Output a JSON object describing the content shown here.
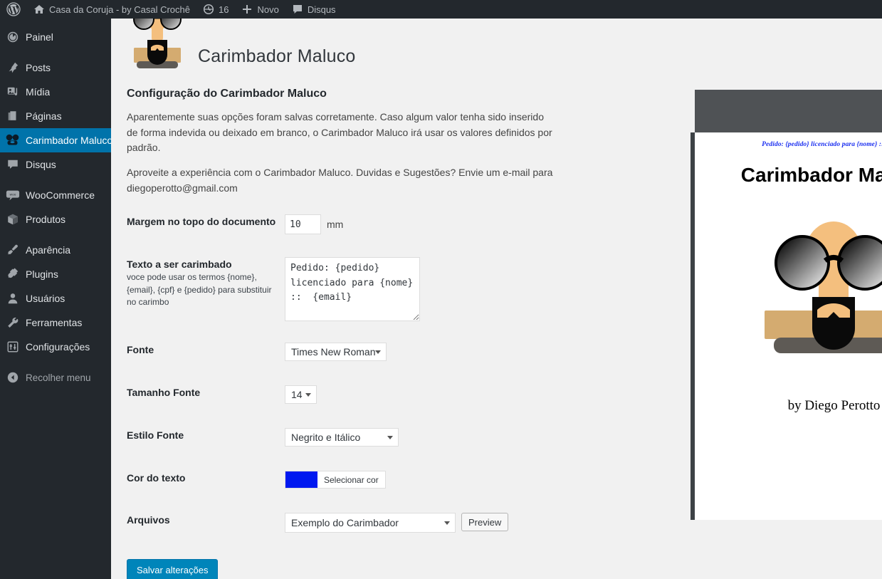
{
  "adminbar": {
    "wp_logo": "wordpress-logo-icon",
    "site": {
      "icon": "home-icon",
      "label": "Casa da Coruja - by Casal Crochê"
    },
    "updates": {
      "icon": "updates-icon",
      "label": "16"
    },
    "new": {
      "icon": "plus-icon",
      "label": "Novo"
    },
    "comments": {
      "icon": "comment-icon",
      "label": "Disqus"
    }
  },
  "sidebar": {
    "items": [
      {
        "label": "Painel",
        "icon": "dashboard-icon",
        "current": false
      },
      {
        "label": "Posts",
        "icon": "pin-icon",
        "current": false
      },
      {
        "label": "Mídia",
        "icon": "media-icon",
        "current": false
      },
      {
        "label": "Páginas",
        "icon": "pages-icon",
        "current": false
      },
      {
        "label": "Carimbador Maluco",
        "icon": "carimbador-icon",
        "current": true
      },
      {
        "label": "Disqus",
        "icon": "comment-icon",
        "current": false
      },
      {
        "label": "WooCommerce",
        "icon": "woocommerce-icon",
        "current": false
      },
      {
        "label": "Produtos",
        "icon": "box-icon",
        "current": false
      },
      {
        "label": "Aparência",
        "icon": "brush-icon",
        "current": false
      },
      {
        "label": "Plugins",
        "icon": "plug-icon",
        "current": false
      },
      {
        "label": "Usuários",
        "icon": "user-icon",
        "current": false
      },
      {
        "label": "Ferramentas",
        "icon": "wrench-icon",
        "current": false
      },
      {
        "label": "Configurações",
        "icon": "settings-icon",
        "current": false
      }
    ],
    "collapse": {
      "label": "Recolher menu",
      "icon": "collapse-arrow-icon"
    }
  },
  "page": {
    "plugin_title": "Carimbador Maluco",
    "section_title": "Configuração do Carimbador Maluco",
    "paragraph1": "Aparentemente suas opções foram salvas corretamente. Caso algum valor tenha sido inserido de forma indevida ou deixado em branco, o Carimbador Maluco irá usar os valores definidos por padrão.",
    "paragraph2": "Aproveite a experiência com o Carimbador Maluco. Duvidas e Sugestões? Envie um e-mail para diegoperotto@gmail.com"
  },
  "form": {
    "margem": {
      "label": "Margem no topo do documento",
      "value": "10",
      "unit": "mm"
    },
    "texto": {
      "label": "Texto a ser carimbado",
      "hint": "voce pode usar os termos {nome}, {email}, {cpf} e {pedido} para substituir no carimbo",
      "value": "Pedido: {pedido} licenciado para {nome} ::  {email}"
    },
    "fonte": {
      "label": "Fonte",
      "value": "Times New Roman"
    },
    "tamanho": {
      "label": "Tamanho Fonte",
      "value": "14"
    },
    "estilo": {
      "label": "Estilo Fonte",
      "value": "Negrito e Itálico"
    },
    "cor": {
      "label": "Cor do texto",
      "button_label": "Selecionar cor",
      "color": "#0018f0"
    },
    "arquivos": {
      "label": "Arquivos",
      "value": "Exemplo do Carimbador",
      "preview_label": "Preview"
    },
    "submit": {
      "label": "Salvar alterações"
    }
  },
  "preview": {
    "stamp_text": "Pedido: {pedido} licenciado para {nome} ::  {email}",
    "doc_title": "Carimbador Maluco",
    "author": "by Diego Perotto",
    "stamp_color": "#1a2ef0",
    "toolbar_color": "#4f5255",
    "scrollbar": {
      "up": "scroll-up-arrow-icon",
      "down": "scroll-down-arrow-icon",
      "thumb": "scroll-thumb"
    }
  }
}
